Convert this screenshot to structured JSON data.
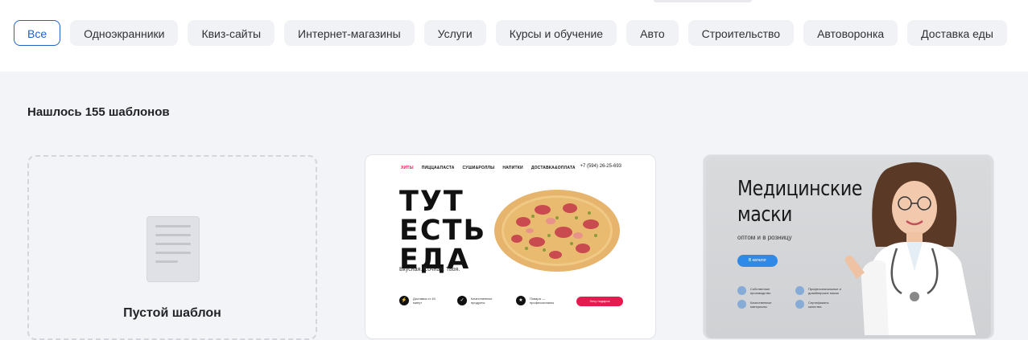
{
  "filters": {
    "chips": [
      {
        "label": "Все",
        "active": true
      },
      {
        "label": "Одноэкранники",
        "active": false
      },
      {
        "label": "Квиз-сайты",
        "active": false
      },
      {
        "label": "Интернет-магазины",
        "active": false
      },
      {
        "label": "Услуги",
        "active": false
      },
      {
        "label": "Курсы и обучение",
        "active": false
      },
      {
        "label": "Авто",
        "active": false
      },
      {
        "label": "Строительство",
        "active": false
      },
      {
        "label": "Автоворонка",
        "active": false
      },
      {
        "label": "Доставка еды",
        "active": false
      }
    ]
  },
  "results": {
    "found_text": "Нашлось 155 шаблонов"
  },
  "cards": {
    "empty": {
      "title": "Пустой шаблон",
      "icon": "document-icon"
    },
    "pizza": {
      "nav": [
        "ХИТЫ",
        "ПИЦЦА&ПАСТА",
        "СУШИ&РОЛЛЫ",
        "НАПИТКИ",
        "ДОСТАВКА&ОПЛАТА"
      ],
      "phone": "+7 (594) 26-25-693",
      "headline": [
        "ТУТ",
        "ЕСТЬ",
        "ЕДА"
      ],
      "subtitle": "Вкусная. Сочная. Твоя.",
      "features": [
        {
          "icon": "lightning-icon",
          "text": "Доставка от 40 минут"
        },
        {
          "icon": "check-icon",
          "text": "Качественные продукты"
        },
        {
          "icon": "star-icon",
          "text": "Повара — профессионалы"
        }
      ],
      "cta": "Хочу подарок",
      "accent": "#e8194f"
    },
    "medical": {
      "title_line1": "Медицинские",
      "title_line2": "маски",
      "subtitle": "оптом и в розницу",
      "cta": "В каталог",
      "features": [
        {
          "text": "Собственное производство"
        },
        {
          "text": "Профессиональные и дизайнерские маски"
        },
        {
          "text": "Качественные материалы"
        },
        {
          "text": "Сертификаты качества"
        }
      ],
      "accent": "#2f89e8"
    }
  }
}
